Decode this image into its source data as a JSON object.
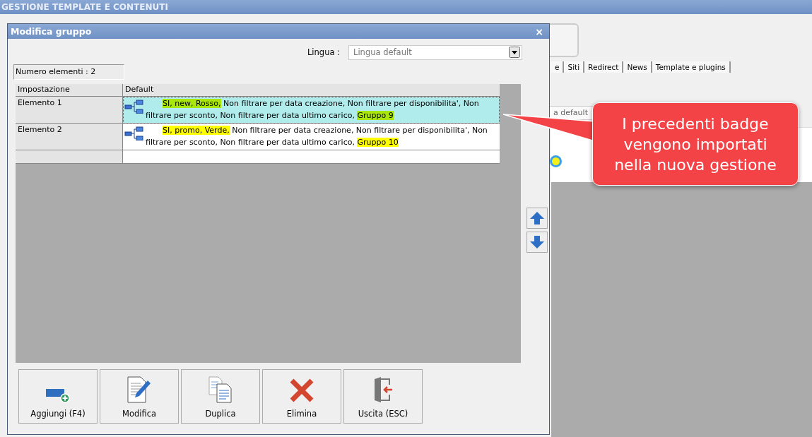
{
  "app": {
    "title": "GESTIONE TEMPLATE E CONTENUTI",
    "tabs": [
      {
        "label": "e",
        "selected": false
      },
      {
        "label": "Siti",
        "selected": false
      },
      {
        "label": "Redirect",
        "selected": false
      },
      {
        "label": "News",
        "selected": false
      },
      {
        "label": "Template e plugins",
        "selected": false
      }
    ],
    "field_value": "a default"
  },
  "dialog": {
    "title": "Modifica gruppo",
    "close": "×",
    "language_label": "Lingua :",
    "language_value": "Lingua default",
    "count": "Numero elementi : 2",
    "table": {
      "columns": [
        "Impostazione",
        "Default"
      ],
      "rows": [
        {
          "name": "Elemento 1",
          "selected": true,
          "badge": "SI, new, Rosso,",
          "text": " Non filtrare per data creazione, Non filtrare per disponibilita', Non filtrare per sconto, Non filtrare per data ultimo carico, ",
          "group": "Gruppo 9"
        },
        {
          "name": "Elemento 2",
          "selected": false,
          "badge": "SI, promo, Verde,",
          "text": " Non filtrare per data creazione, Non filtrare per disponibilita', Non filtrare per sconto, Non filtrare per data ultimo carico, ",
          "group": "Gruppo 10"
        }
      ]
    },
    "buttons": [
      {
        "label": "Aggiungi (F4)",
        "kind": "add"
      },
      {
        "label": "Modifica",
        "kind": "edit"
      },
      {
        "label": "Duplica",
        "kind": "copy"
      },
      {
        "label": "Elimina",
        "kind": "delete"
      },
      {
        "label": "Uscita (ESC)",
        "kind": "exit"
      }
    ]
  },
  "callout": {
    "text": "I precedenti badge vengono importati nella nuova gestione"
  }
}
